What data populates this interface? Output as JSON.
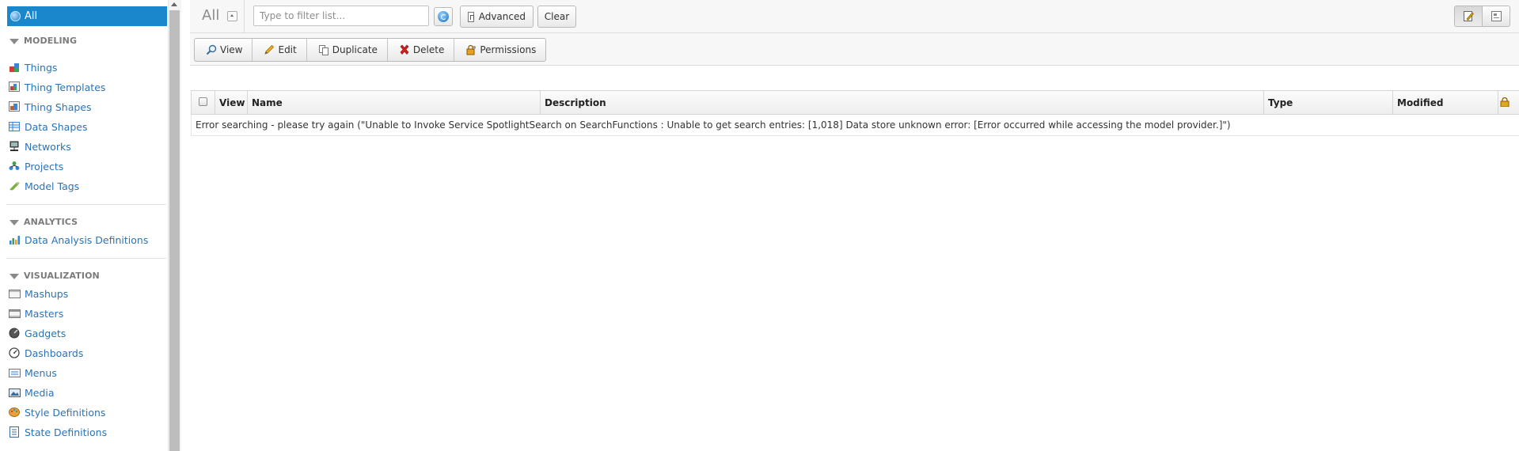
{
  "sidebar": {
    "all_label": "All",
    "sections": [
      {
        "title": "MODELING",
        "items": [
          {
            "label": "Things",
            "icon": "things-icon"
          },
          {
            "label": "Thing Templates",
            "icon": "thing-templates-icon"
          },
          {
            "label": "Thing Shapes",
            "icon": "thing-shapes-icon"
          },
          {
            "label": "Data Shapes",
            "icon": "data-shapes-icon"
          },
          {
            "label": "Networks",
            "icon": "networks-icon"
          },
          {
            "label": "Projects",
            "icon": "projects-icon"
          },
          {
            "label": "Model Tags",
            "icon": "model-tags-icon"
          }
        ]
      },
      {
        "title": "ANALYTICS",
        "items": [
          {
            "label": "Data Analysis Definitions",
            "icon": "bar-chart-icon"
          }
        ]
      },
      {
        "title": "VISUALIZATION",
        "items": [
          {
            "label": "Mashups",
            "icon": "mashups-icon"
          },
          {
            "label": "Masters",
            "icon": "masters-icon"
          },
          {
            "label": "Gadgets",
            "icon": "gadgets-icon"
          },
          {
            "label": "Dashboards",
            "icon": "dashboards-icon"
          },
          {
            "label": "Menus",
            "icon": "menus-icon"
          },
          {
            "label": "Media",
            "icon": "media-icon"
          },
          {
            "label": "Style Definitions",
            "icon": "palette-icon"
          },
          {
            "label": "State Definitions",
            "icon": "state-definitions-icon"
          }
        ]
      }
    ]
  },
  "toolbar": {
    "title": "All",
    "filter_placeholder": "Type to filter list...",
    "filter_value": "",
    "advanced_label": "Advanced",
    "clear_label": "Clear"
  },
  "actions": {
    "view_label": "View",
    "edit_label": "Edit",
    "duplicate_label": "Duplicate",
    "delete_label": "Delete",
    "permissions_label": "Permissions"
  },
  "grid": {
    "columns": {
      "view": "View",
      "name": "Name",
      "description": "Description",
      "type": "Type",
      "modified": "Modified"
    },
    "message": "Error searching - please try again (\"Unable to Invoke Service SpotlightSearch on SearchFunctions : Unable to get search entries: [1,018] Data store unknown error: [Error occurred while accessing the model provider.]\")"
  },
  "colors": {
    "accent": "#1a86cc",
    "link": "#2a73b8",
    "delete_red": "#cc2222"
  }
}
